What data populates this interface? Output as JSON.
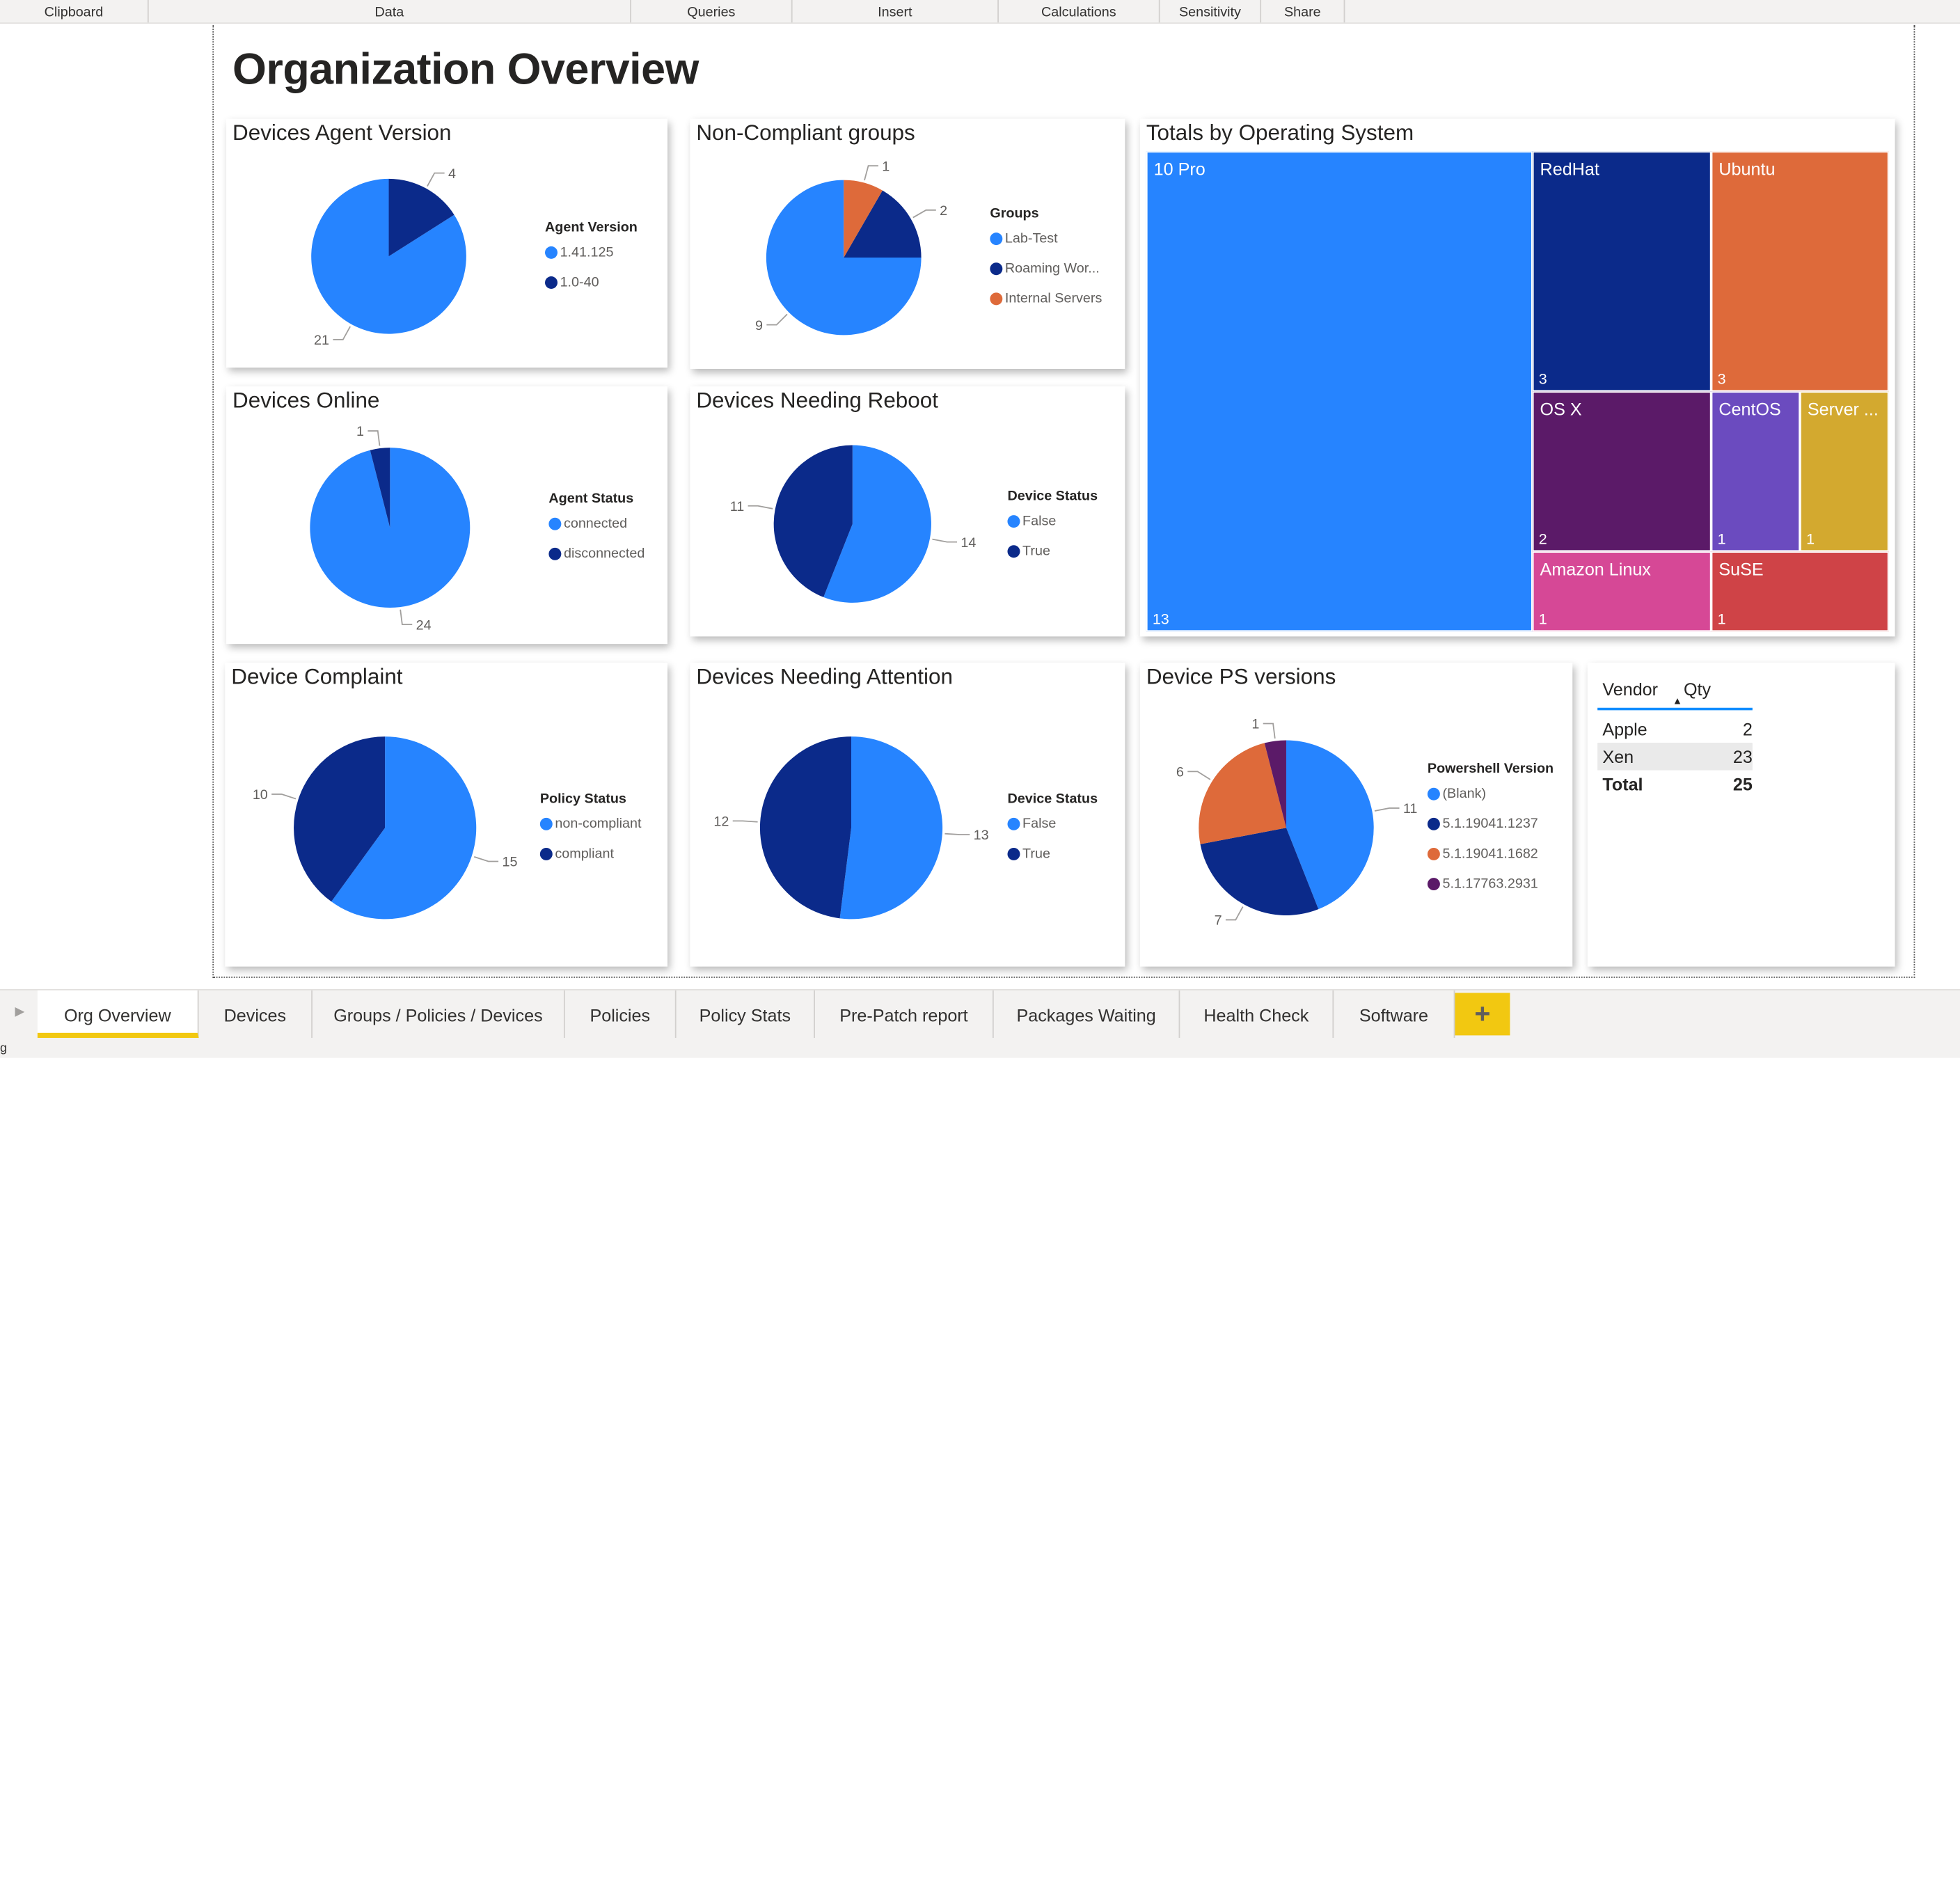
{
  "ribbon": {
    "groups": [
      "Clipboard",
      "Data",
      "Queries",
      "Insert",
      "Calculations",
      "Sensitivity",
      "Share"
    ]
  },
  "report": {
    "title": "Organization Overview"
  },
  "colors": {
    "blue": "#2684ff",
    "darkblue": "#0b2a8a",
    "orange": "#de6a3a",
    "purple": "#5b1a68",
    "violet": "#6b4bbf",
    "gold": "#d3a92f",
    "pink": "#d64896",
    "red": "#cf4347",
    "tab_accent": "#f2c811"
  },
  "cards": {
    "agent_version": {
      "title": "Devices Agent Version",
      "legend_title": "Agent Version",
      "slices": [
        {
          "label": "1.41.125",
          "value": 21,
          "color": "#2684ff"
        },
        {
          "label": "1.0-40",
          "value": 4,
          "color": "#0b2a8a"
        }
      ]
    },
    "noncompliant_groups": {
      "title": "Non-Compliant groups",
      "legend_title": "Groups",
      "slices": [
        {
          "label": "Lab-Test",
          "value": 9,
          "color": "#2684ff"
        },
        {
          "label": "Roaming Wor...",
          "value": 2,
          "color": "#0b2a8a"
        },
        {
          "label": "Internal Servers",
          "value": 1,
          "color": "#de6a3a"
        }
      ]
    },
    "devices_online": {
      "title": "Devices Online",
      "legend_title": "Agent Status",
      "slices": [
        {
          "label": "connected",
          "value": 24,
          "color": "#2684ff"
        },
        {
          "label": "disconnected",
          "value": 1,
          "color": "#0b2a8a"
        }
      ]
    },
    "needing_reboot": {
      "title": "Devices Needing Reboot",
      "legend_title": "Device Status",
      "slices": [
        {
          "label": "False",
          "value": 14,
          "color": "#2684ff"
        },
        {
          "label": "True",
          "value": 11,
          "color": "#0b2a8a"
        }
      ]
    },
    "device_compliant": {
      "title": "Device Complaint",
      "legend_title": "Policy Status",
      "slices": [
        {
          "label": "non-compliant",
          "value": 15,
          "color": "#2684ff"
        },
        {
          "label": "compliant",
          "value": 10,
          "color": "#0b2a8a"
        }
      ]
    },
    "needing_attention": {
      "title": "Devices Needing Attention",
      "legend_title": "Device Status",
      "slices": [
        {
          "label": "False",
          "value": 13,
          "color": "#2684ff"
        },
        {
          "label": "True",
          "value": 12,
          "color": "#0b2a8a"
        }
      ]
    },
    "ps_versions": {
      "title": "Device PS versions",
      "legend_title": "Powershell Version",
      "slices": [
        {
          "label": "(Blank)",
          "value": 11,
          "color": "#2684ff"
        },
        {
          "label": "5.1.19041.1237",
          "value": 7,
          "color": "#0b2a8a"
        },
        {
          "label": "5.1.19041.1682",
          "value": 6,
          "color": "#de6a3a"
        },
        {
          "label": "5.1.17763.2931",
          "value": 1,
          "color": "#5b1a68"
        }
      ]
    },
    "totals_os": {
      "title": "Totals by Operating System",
      "cells": [
        {
          "label": "10 Pro",
          "value": "13"
        },
        {
          "label": "RedHat",
          "value": "3"
        },
        {
          "label": "Ubuntu",
          "value": "3"
        },
        {
          "label": "OS X",
          "value": "2"
        },
        {
          "label": "CentOS",
          "value": "1"
        },
        {
          "label": "Server ...",
          "value": "1"
        },
        {
          "label": "Amazon Linux",
          "value": "1"
        },
        {
          "label": "SuSE",
          "value": "1"
        }
      ]
    },
    "vendor_table": {
      "headers": {
        "vendor": "Vendor",
        "qty": "Qty"
      },
      "rows": [
        {
          "vendor": "Apple",
          "qty": "2"
        },
        {
          "vendor": "Xen",
          "qty": "23"
        }
      ],
      "total": {
        "label": "Total",
        "qty": "25"
      }
    }
  },
  "chart_data": [
    {
      "type": "pie",
      "title": "Devices Agent Version",
      "legend_title": "Agent Version",
      "categories": [
        "1.41.125",
        "1.0-40"
      ],
      "values": [
        21,
        4
      ]
    },
    {
      "type": "pie",
      "title": "Non-Compliant groups",
      "legend_title": "Groups",
      "categories": [
        "Lab-Test",
        "Roaming Wor...",
        "Internal Servers"
      ],
      "values": [
        9,
        2,
        1
      ]
    },
    {
      "type": "pie",
      "title": "Devices Online",
      "legend_title": "Agent Status",
      "categories": [
        "connected",
        "disconnected"
      ],
      "values": [
        24,
        1
      ]
    },
    {
      "type": "pie",
      "title": "Devices Needing Reboot",
      "legend_title": "Device Status",
      "categories": [
        "False",
        "True"
      ],
      "values": [
        14,
        11
      ]
    },
    {
      "type": "pie",
      "title": "Device Complaint",
      "legend_title": "Policy Status",
      "categories": [
        "non-compliant",
        "compliant"
      ],
      "values": [
        15,
        10
      ]
    },
    {
      "type": "pie",
      "title": "Devices Needing Attention",
      "legend_title": "Device Status",
      "categories": [
        "False",
        "True"
      ],
      "values": [
        13,
        12
      ]
    },
    {
      "type": "pie",
      "title": "Device PS versions",
      "legend_title": "Powershell Version",
      "categories": [
        "(Blank)",
        "5.1.19041.1237",
        "5.1.19041.1682",
        "5.1.17763.2931"
      ],
      "values": [
        11,
        7,
        6,
        1
      ]
    },
    {
      "type": "treemap",
      "title": "Totals by Operating System",
      "categories": [
        "10 Pro",
        "RedHat",
        "Ubuntu",
        "OS X",
        "CentOS",
        "Server ...",
        "Amazon Linux",
        "SuSE"
      ],
      "values": [
        13,
        3,
        3,
        2,
        1,
        1,
        1,
        1
      ]
    },
    {
      "type": "table",
      "columns": [
        "Vendor",
        "Qty"
      ],
      "rows": [
        [
          "Apple",
          2
        ],
        [
          "Xen",
          23
        ]
      ],
      "total": [
        "Total",
        25
      ]
    }
  ],
  "tabs": {
    "items": [
      "Org Overview",
      "Devices",
      "Groups / Policies / Devices",
      "Policies",
      "Policy Stats",
      "Pre-Patch report",
      "Packages Waiting",
      "Health Check",
      "Software"
    ],
    "add_label": "+"
  },
  "status": {
    "text": "g"
  }
}
